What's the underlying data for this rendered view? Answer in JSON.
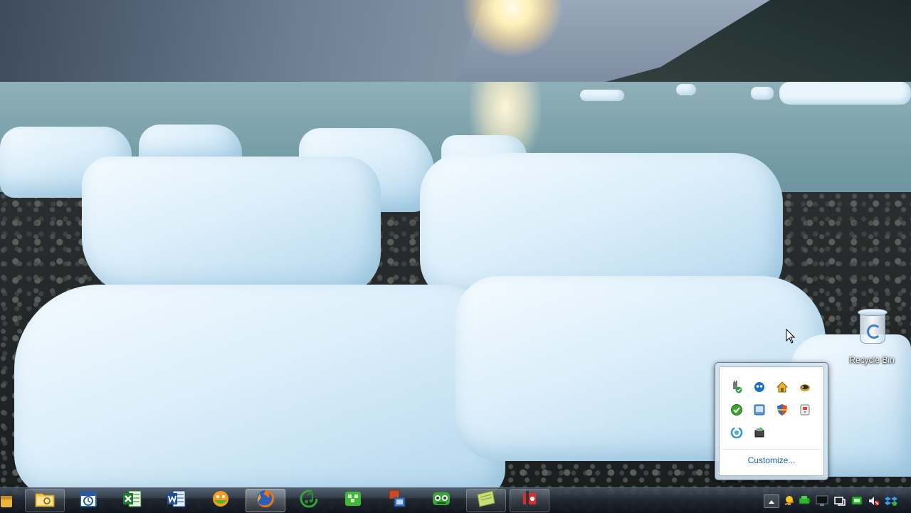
{
  "desktop": {
    "recycle_bin_label": "Recycle Bin"
  },
  "notification_overflow": {
    "icons": [
      "power-plug-icon",
      "pidgin-chat-icon",
      "network-home-icon",
      "bird-icon",
      "update-check-icon",
      "display-icon",
      "security-shield-icon",
      "disk-icon",
      "sync-icon",
      "safely-remove-icon"
    ],
    "customize_label": "Customize..."
  },
  "taskbar": {
    "pinned": [
      "explorer-icon",
      "outlook-calendar-icon",
      "excel-icon",
      "word-icon",
      "messenger-icon",
      "firefox-icon",
      "itunes-icon",
      "puzzle-game-icon",
      "remote-desktop-icon",
      "robot-app-icon",
      "notes-icon",
      "media-recorder-icon"
    ],
    "active_app": "firefox-icon"
  },
  "tray": {
    "icons": [
      "show-hidden-icons",
      "lightbulb-icon",
      "battery-icon",
      "display-icon",
      "action-center-icon",
      "network-icon",
      "volume-muted-icon",
      "dropbox-icon"
    ]
  },
  "colors": {
    "link": "#1a5fb4",
    "taskbar": "#1e2630"
  }
}
